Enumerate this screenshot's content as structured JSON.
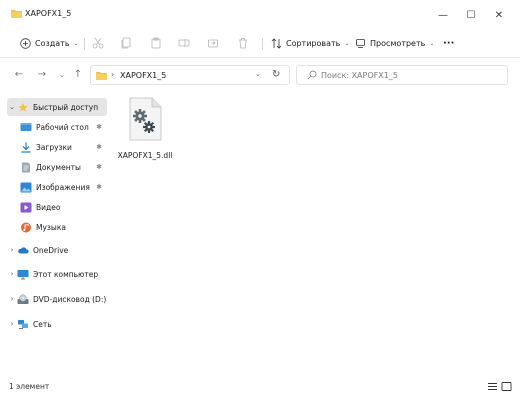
{
  "window": {
    "title": "XAPOFX1_5",
    "minimize_label": "—",
    "maximize_label": "☐",
    "close_label": "✕"
  },
  "toolbar": {
    "create_label": "Создать",
    "sort_label": "Сортировать",
    "view_label": "Просмотреть",
    "more_label": "···"
  },
  "address": {
    "crumb": "XAPOFX1_5",
    "search_placeholder": "Поиск: XAPOFX1_5"
  },
  "sidebar": {
    "items": [
      {
        "label": "Быстрый доступ",
        "icon": "star-icon"
      },
      {
        "label": "Рабочий стол",
        "icon": "desktop-icon"
      },
      {
        "label": "Загрузки",
        "icon": "download-icon"
      },
      {
        "label": "Документы",
        "icon": "documents-icon"
      },
      {
        "label": "Изображения",
        "icon": "pictures-icon"
      },
      {
        "label": "Видео",
        "icon": "video-icon"
      },
      {
        "label": "Музыка",
        "icon": "music-icon"
      },
      {
        "label": "OneDrive",
        "icon": "cloud-icon"
      },
      {
        "label": "Этот компьютер",
        "icon": "computer-icon"
      },
      {
        "label": "DVD-дисковод (D:)",
        "icon": "dvd-icon"
      },
      {
        "label": "Сеть",
        "icon": "network-icon"
      }
    ]
  },
  "files": [
    {
      "name": "XAPOFX1_5.dll",
      "icon": "dll-gear-icon"
    }
  ],
  "status": {
    "count": "1 элемент"
  },
  "colors": {
    "folder": "#f3c04a",
    "accent": "#0067c0",
    "selected": "#e5e5e5"
  }
}
